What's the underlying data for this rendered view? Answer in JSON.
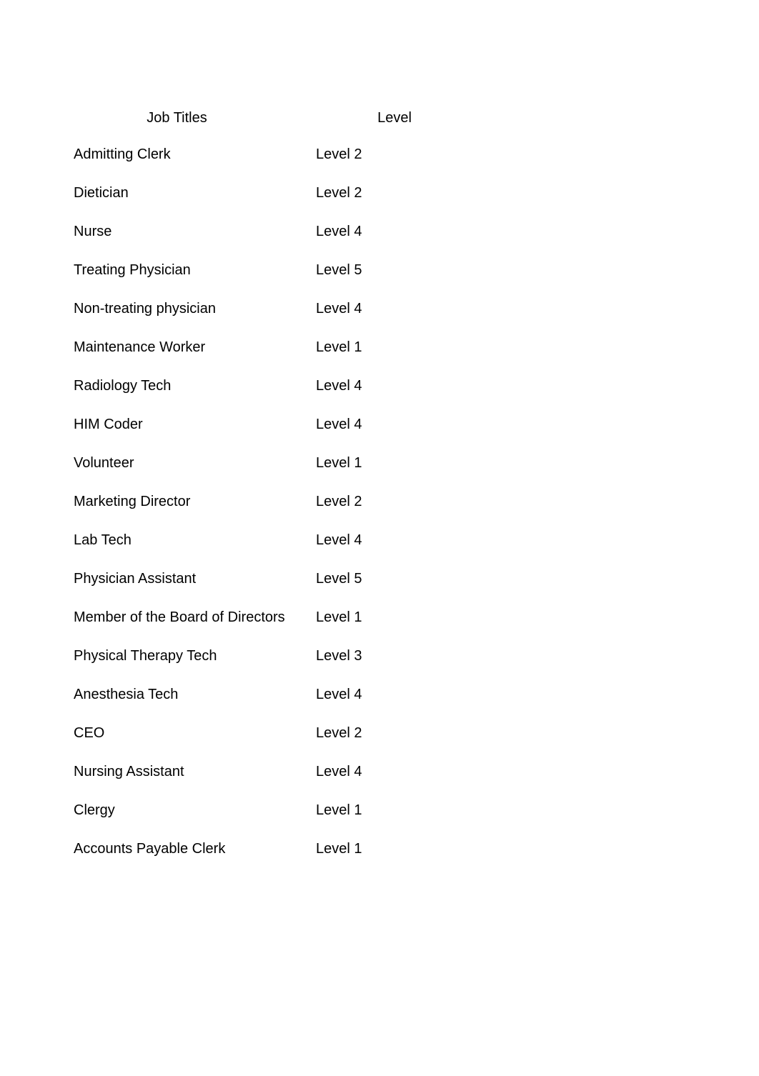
{
  "headers": {
    "job_titles": "Job Titles",
    "level": "Level"
  },
  "rows": [
    {
      "title": "Admitting Clerk",
      "level": "Level 2"
    },
    {
      "title": "Dietician",
      "level": "Level 2"
    },
    {
      "title": "Nurse",
      "level": "Level 4"
    },
    {
      "title": "Treating Physician",
      "level": "Level 5"
    },
    {
      "title": "Non-treating physician",
      "level": "Level 4"
    },
    {
      "title": "Maintenance Worker",
      "level": "Level 1"
    },
    {
      "title": "Radiology Tech",
      "level": "Level 4"
    },
    {
      "title": "HIM Coder",
      "level": "Level 4"
    },
    {
      "title": "Volunteer",
      "level": "Level 1"
    },
    {
      "title": "Marketing Director",
      "level": "Level 2"
    },
    {
      "title": "Lab Tech",
      "level": "Level 4"
    },
    {
      "title": "Physician Assistant",
      "level": "Level 5"
    },
    {
      "title": "Member of the Board of Directors",
      "level": "Level 1"
    },
    {
      "title": "Physical Therapy Tech",
      "level": "Level 3"
    },
    {
      "title": "Anesthesia Tech",
      "level": "Level 4"
    },
    {
      "title": "CEO",
      "level": "Level 2"
    },
    {
      "title": "Nursing Assistant",
      "level": "Level 4"
    },
    {
      "title": "Clergy",
      "level": "Level 1"
    },
    {
      "title": "Accounts Payable Clerk",
      "level": "Level 1"
    }
  ]
}
